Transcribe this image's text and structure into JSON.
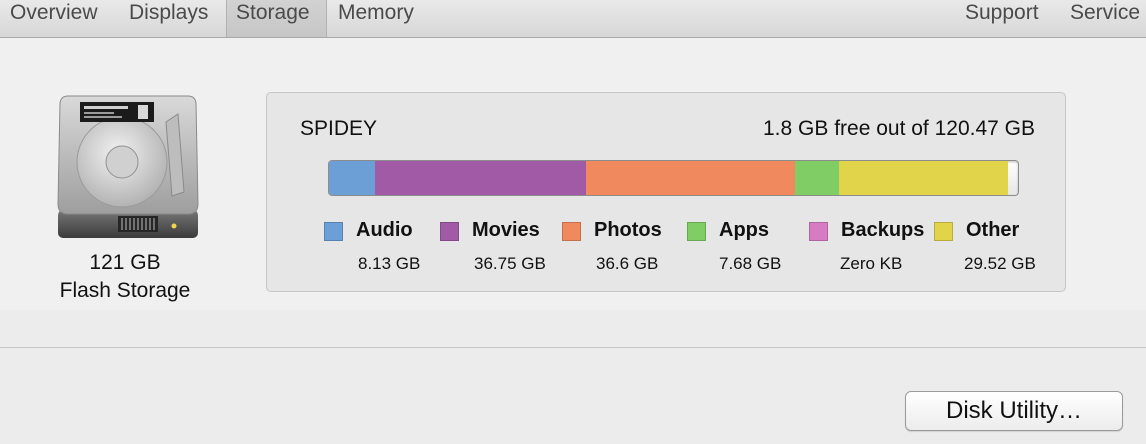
{
  "tabs": [
    {
      "label": "Overview",
      "selected": false
    },
    {
      "label": "Displays",
      "selected": false
    },
    {
      "label": "Storage",
      "selected": true
    },
    {
      "label": "Memory",
      "selected": false
    },
    {
      "label": "Support",
      "selected": false
    },
    {
      "label": "Service",
      "selected": false
    }
  ],
  "drive": {
    "icon": "hard-drive-icon",
    "capacity": "121 GB",
    "type": "Flash Storage"
  },
  "volume": {
    "name": "SPIDEY",
    "free_text": "1.8 GB free out of 120.47 GB",
    "total_gb": 120.47,
    "free_gb": 1.8
  },
  "usage": [
    {
      "name": "Audio",
      "size": "8.13 GB",
      "gb": 8.13,
      "color": "#6b9fd6"
    },
    {
      "name": "Movies",
      "size": "36.75 GB",
      "gb": 36.75,
      "color": "#a05aa6"
    },
    {
      "name": "Photos",
      "size": "36.6 GB",
      "gb": 36.6,
      "color": "#f0895e"
    },
    {
      "name": "Apps",
      "size": "7.68 GB",
      "gb": 7.68,
      "color": "#7fcd64"
    },
    {
      "name": "Backups",
      "size": "Zero KB",
      "gb": 0,
      "color": "#d67cc3"
    },
    {
      "name": "Other",
      "size": "29.52 GB",
      "gb": 29.52,
      "color": "#e1d44a"
    }
  ],
  "button": {
    "label": "Disk Utility…"
  }
}
